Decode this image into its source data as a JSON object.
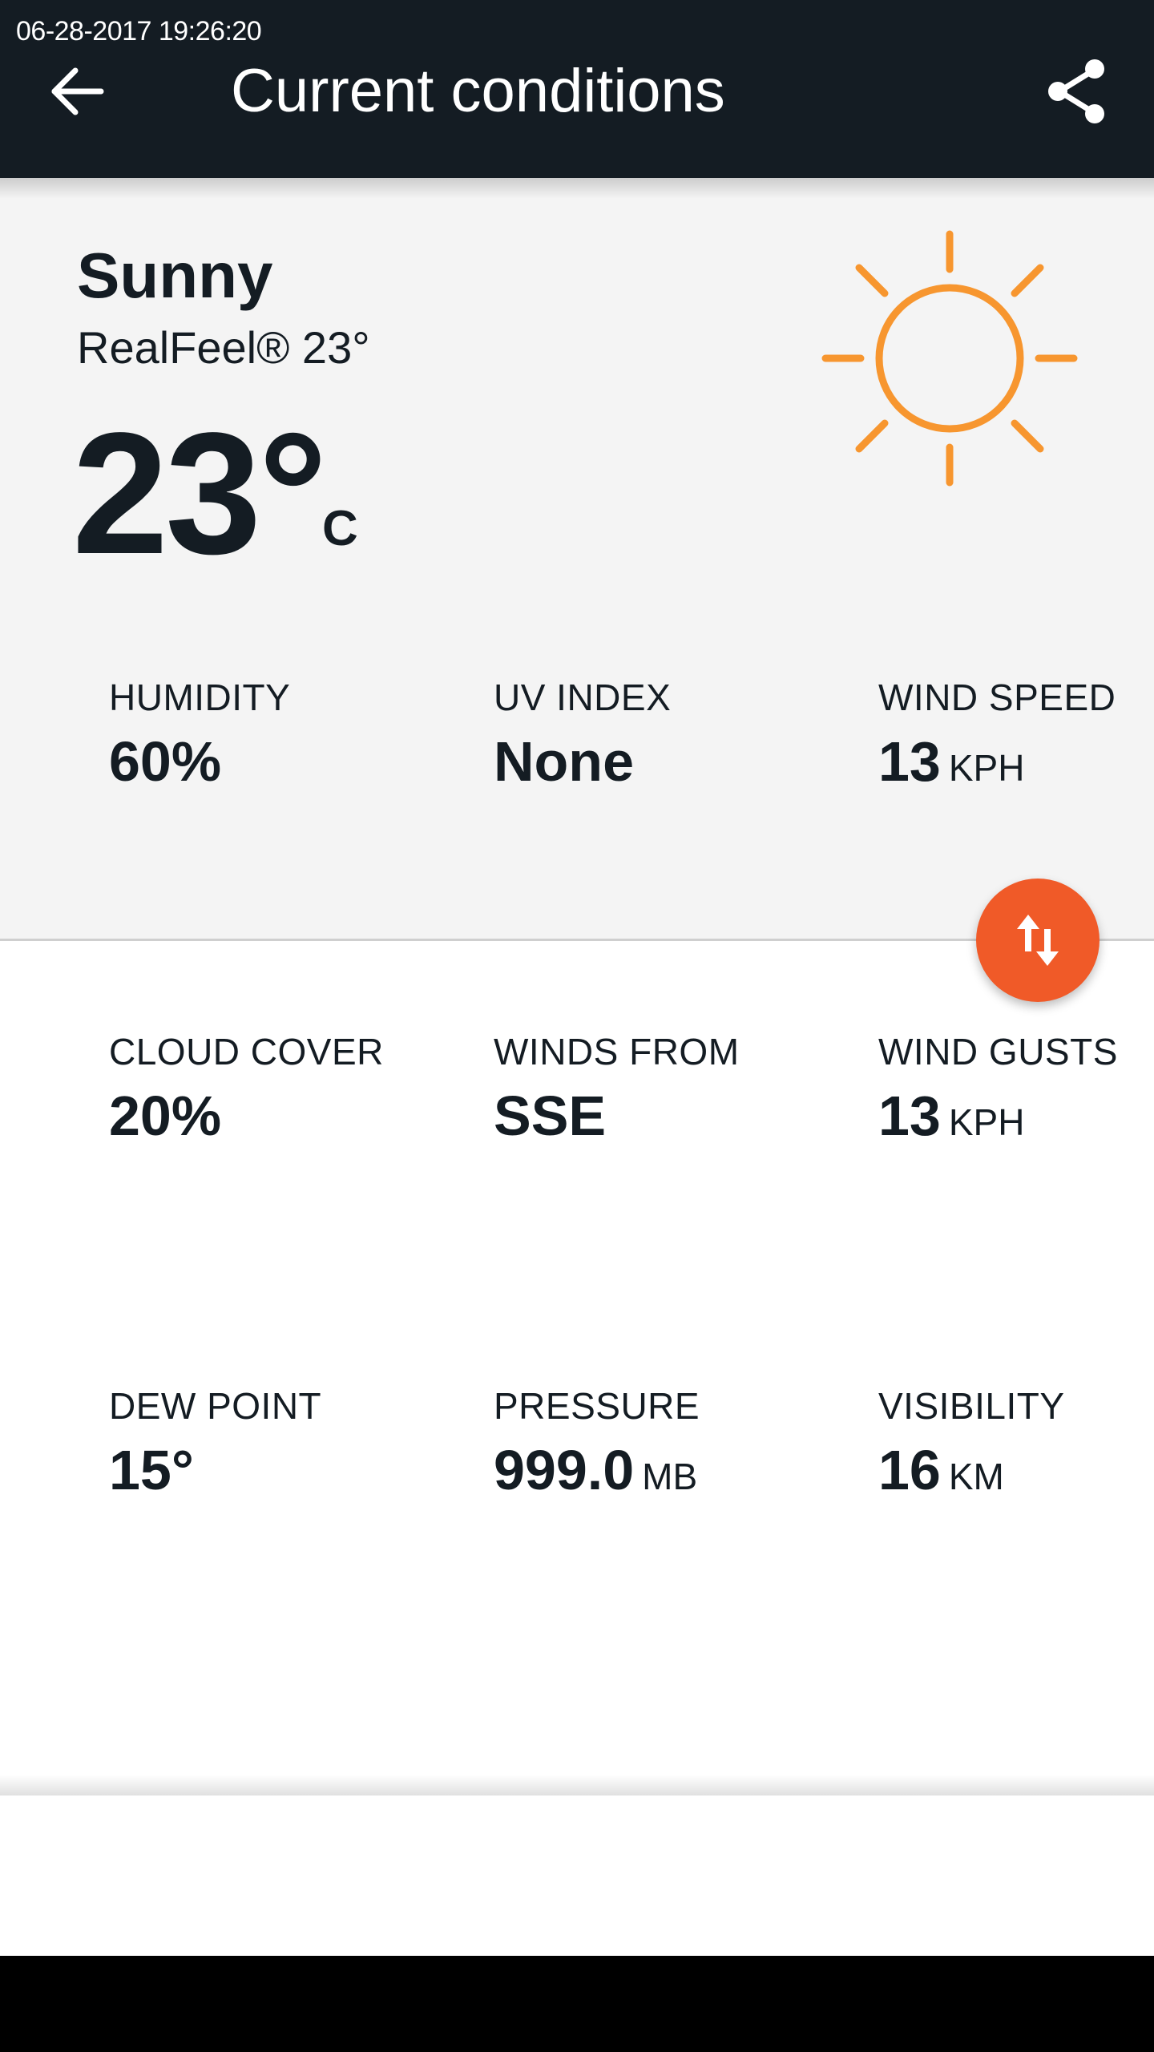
{
  "status_bar": {
    "timestamp": "06-28-2017 19:26:20"
  },
  "header": {
    "title": "Current conditions",
    "back_icon": "arrow-left-icon",
    "share_icon": "share-icon"
  },
  "current": {
    "condition": "Sunny",
    "realfeel": "RealFeel® 23°",
    "temperature": "23°",
    "temperature_unit": "C",
    "weather_icon": "sun-icon",
    "icon_color": "#f7962f"
  },
  "details": [
    {
      "label": "HUMIDITY",
      "value": "60%",
      "unit": ""
    },
    {
      "label": "UV INDEX",
      "value": "None",
      "unit": ""
    },
    {
      "label": "WIND SPEED",
      "value": "13",
      "unit": "KPH"
    },
    {
      "label": "CLOUD COVER",
      "value": "20%",
      "unit": ""
    },
    {
      "label": "WINDS FROM",
      "value": "SSE",
      "unit": ""
    },
    {
      "label": "WIND GUSTS",
      "value": "13",
      "unit": "KPH"
    },
    {
      "label": "DEW POINT",
      "value": "15°",
      "unit": ""
    },
    {
      "label": "PRESSURE",
      "value": "999.0",
      "unit": "MB"
    },
    {
      "label": "VISIBILITY",
      "value": "16",
      "unit": "KM"
    }
  ],
  "fab": {
    "icon": "swap-vertical-icon",
    "color": "#f05a28"
  },
  "colors": {
    "header_bg": "#141c23",
    "hero_bg": "#f4f4f4",
    "text": "#141c23"
  }
}
